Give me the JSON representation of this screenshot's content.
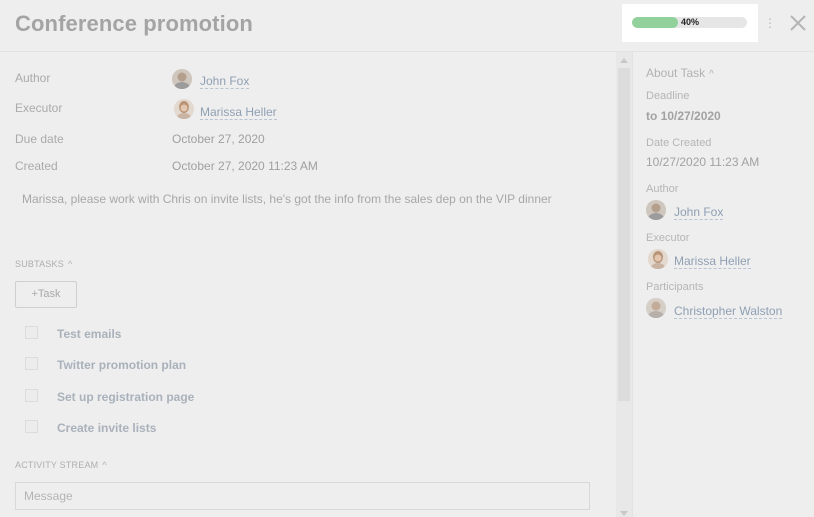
{
  "header": {
    "title": "Conference promotion",
    "progress_value": 40,
    "progress_label": "40%",
    "menu_icon": "more-vertical-icon",
    "close_icon": "close-icon"
  },
  "fields": {
    "author_label": "Author",
    "author_name": "John Fox",
    "executor_label": "Executor",
    "executor_name": "Marissa Heller",
    "due_label": "Due date",
    "due_value": "October 27, 2020",
    "created_label": "Created",
    "created_value": "October 27, 2020 11:23 AM"
  },
  "description": "Marissa, please work with Chris on invite lists, he's got the info from the sales dep on the VIP dinner",
  "subtasks": {
    "title": "SUBTASKS",
    "add_label": "+Task",
    "items": [
      {
        "label": "Test emails"
      },
      {
        "label": "Twitter promotion plan"
      },
      {
        "label": "Set up registration page"
      },
      {
        "label": "Create invite lists"
      }
    ]
  },
  "activity": {
    "title": "ACTIVITY STREAM",
    "placeholder": "Message"
  },
  "sidebar": {
    "title": "About Task",
    "deadline_label": "Deadline",
    "deadline_value": "to 10/27/2020",
    "date_created_label": "Date Created",
    "date_created_value": "10/27/2020 11:23 AM",
    "author_label": "Author",
    "author_name": "John Fox",
    "executor_label": "Executor",
    "executor_name": "Marissa Heller",
    "participants_label": "Participants",
    "participant_name": "Christopher Walston"
  },
  "colors": {
    "progress_fill": "#93d19c",
    "link": "#8f9fb3"
  }
}
